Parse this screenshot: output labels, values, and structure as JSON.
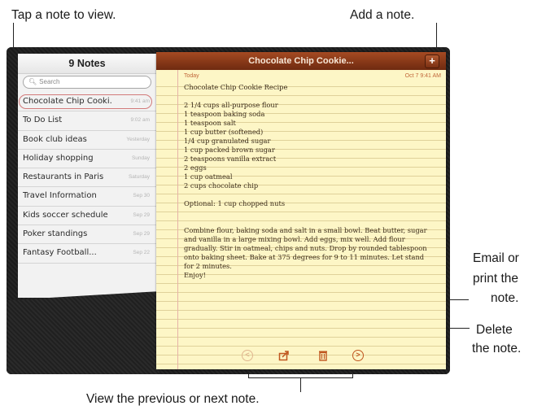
{
  "callouts": {
    "tap_note": "Tap a note to view.",
    "add_note": "Add a note.",
    "email_print": [
      "Email or",
      "print the",
      "note."
    ],
    "delete": [
      "Delete",
      "the note."
    ],
    "prev_next": "View the previous or next note."
  },
  "sidebar": {
    "title": "9 Notes",
    "search_placeholder": "Search",
    "notes": [
      {
        "title": "Chocolate Chip Cooki...",
        "time": "9:41 am"
      },
      {
        "title": "To Do List",
        "time": "9:02 am"
      },
      {
        "title": "Book club ideas",
        "time": "Yesterday"
      },
      {
        "title": "Holiday shopping",
        "time": "Sunday"
      },
      {
        "title": "Restaurants in Paris",
        "time": "Saturday"
      },
      {
        "title": "Travel Information",
        "time": "Sep 30"
      },
      {
        "title": "Kids soccer schedule",
        "time": "Sep 29"
      },
      {
        "title": "Poker standings",
        "time": "Sep 29"
      },
      {
        "title": "Fantasy Football...",
        "time": "Sep 22"
      }
    ]
  },
  "note": {
    "header_title": "Chocolate Chip Cookie...",
    "add_label": "+",
    "date_left": "Today",
    "date_right": "Oct 7  9:41 AM",
    "body": "Chocolate Chip Cookie Recipe\n\n2 1/4 cups all-purpose flour\n1 teaspoon baking soda\n1 teaspoon salt\n1 cup butter (softened)\n1/4 cup granulated sugar\n1 cup packed brown sugar\n2 teaspoons vanilla extract\n2 eggs\n1 cup oatmeal\n2 cups chocolate chip\n\nOptional: 1 cup chopped nuts\n\n\nCombine flour, baking soda and salt in a small bowl. Beat butter, sugar and vanilla in a large mixing bowl. Add eggs, mix well. Add flour gradually. Stir in oatmeal, chips and nuts. Drop by rounded tablespoon onto baking sheet. Bake at 375 degrees for 9 to 11 minutes. Let stand for 2 minutes.\nEnjoy!"
  },
  "toolbar": {
    "prev_icon": "previous-arrow-icon",
    "share_icon": "share-icon",
    "trash_icon": "trash-icon",
    "next_icon": "next-arrow-icon",
    "prev_glyph": "<",
    "next_glyph": ">",
    "accent_color": "#c0561f"
  }
}
